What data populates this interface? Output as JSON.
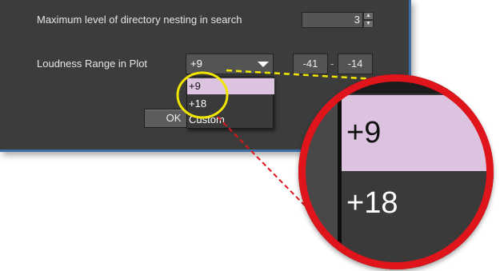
{
  "settings": {
    "max_nesting_label": "Maximum level of directory nesting in search",
    "max_nesting_value": "3",
    "loudness_label": "Loudness Range in Plot",
    "loudness_selected": "+9",
    "range_min": "-41",
    "range_separator": "-",
    "range_max": "-14"
  },
  "dropdown": {
    "options": [
      "+9",
      "+18",
      "Custom"
    ],
    "highlighted_index": 0
  },
  "buttons": {
    "ok_label": "OK"
  },
  "magnifier": {
    "items": [
      "+9",
      "+18"
    ]
  },
  "colors": {
    "dialog_bg": "#3c3c3c",
    "highlight": "#dcc3df",
    "callout_yellow": "#f2e600",
    "callout_red": "#e0141b",
    "window_border": "#3e6ea6"
  }
}
